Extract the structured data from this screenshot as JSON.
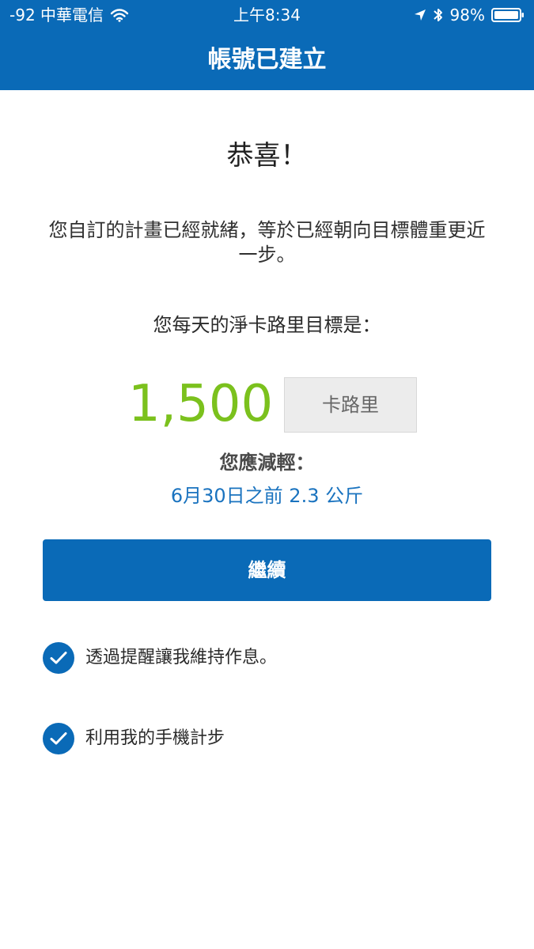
{
  "status_bar": {
    "carrier": "-92 中華電信",
    "time": "上午8:34",
    "battery": "98%"
  },
  "header": {
    "title": "帳號已建立"
  },
  "main": {
    "headline": "恭喜！",
    "message": "您自訂的計畫已經就緒，等於已經朝向目標體重更近一步。",
    "goal_label": "您每天的淨卡路里目標是：",
    "goal_value": "1,500",
    "goal_unit": "卡路里",
    "lose_label": "您應減輕：",
    "lose_detail": "6月30日之前 2.3 公斤",
    "continue_label": "繼續"
  },
  "options": [
    {
      "label": "透過提醒讓我維持作息。",
      "checked": true
    },
    {
      "label": "利用我的手機計步",
      "checked": true
    }
  ],
  "colors": {
    "brand_blue": "#0a6ab7",
    "goal_green": "#7bc11d",
    "link_blue": "#1a73bf"
  },
  "icons": {
    "wifi": "wifi-icon",
    "location": "location-arrow-icon",
    "bluetooth": "bluetooth-icon",
    "battery": "battery-icon",
    "check": "check-circle-icon"
  }
}
